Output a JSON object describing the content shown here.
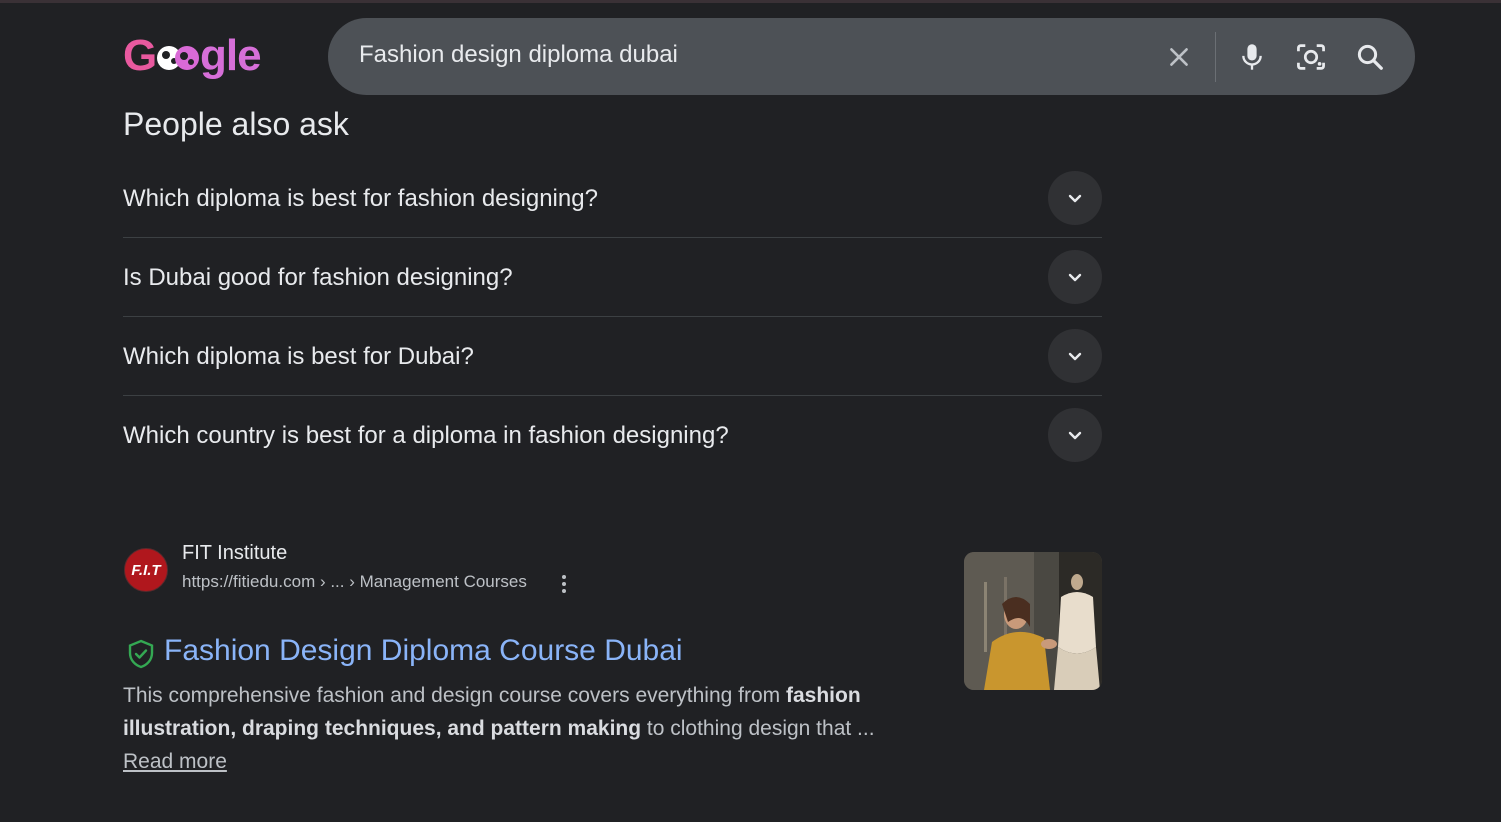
{
  "logo": {
    "text": "Google"
  },
  "search": {
    "query": "Fashion design diploma dubai",
    "icons": [
      "close-icon",
      "microphone-icon",
      "lens-icon",
      "search-icon"
    ]
  },
  "people_also_ask": {
    "title": "People also ask",
    "questions": [
      "Which diploma is best for fashion designing?",
      "Is Dubai good for fashion designing?",
      "Which diploma is best for Dubai?",
      "Which country is best for a diploma in fashion designing?"
    ]
  },
  "result": {
    "favicon_text": "F.I.T",
    "site_name": "FIT Institute",
    "url": "https://fitiedu.com › ... › Management Courses",
    "title": "Fashion Design Diploma Course Dubai",
    "snippet": {
      "part1": "This comprehensive fashion and design course covers everything from ",
      "bold1": "fashion illustration, draping techniques, and pattern making",
      "part2": " to clothing design that ... ",
      "read_more": "Read more"
    }
  },
  "colors": {
    "background": "#202124",
    "search_bg": "#4d5156",
    "link": "#8ab4f8",
    "logo_pink": "#e8599f",
    "shield_green": "#34a853"
  }
}
